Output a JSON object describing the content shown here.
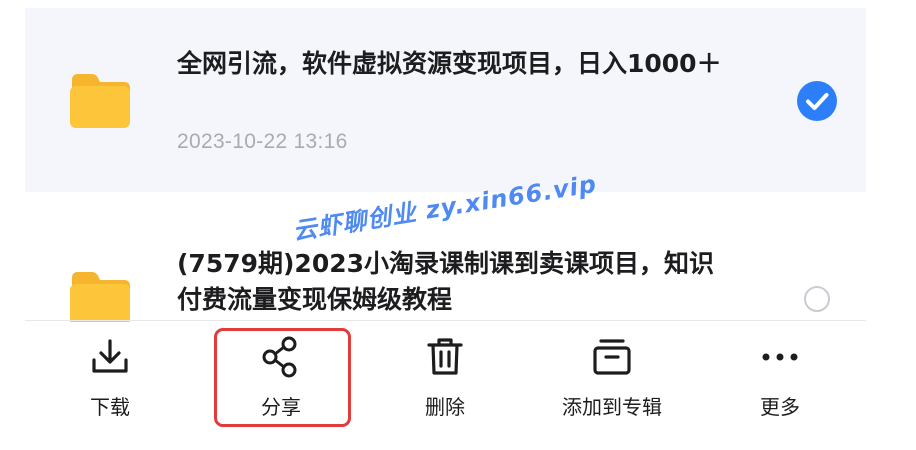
{
  "files": [
    {
      "title": "全网引流，软件虚拟资源变现项目，日入1000＋",
      "date": "2023-10-22 13:16",
      "selected": true,
      "icon": "folder-icon"
    },
    {
      "title": "(7579期)2023小淘录课制课到卖课项目，知识付费流量变现保姆级教程",
      "selected": false,
      "icon": "folder-icon"
    }
  ],
  "toolbar": {
    "download": {
      "label": "下载",
      "icon": "download-icon"
    },
    "share": {
      "label": "分享",
      "icon": "share-icon"
    },
    "delete": {
      "label": "删除",
      "icon": "trash-icon"
    },
    "add_to_album": {
      "label": "添加到专辑",
      "icon": "album-icon"
    },
    "more": {
      "label": "更多",
      "icon": "more-icon"
    }
  },
  "watermark": {
    "text": "云虾聊创业 zy.xin66.vip"
  },
  "colors": {
    "selected_bg": "#f4f6fb",
    "check_blue": "#2d7ff9",
    "folder_yellow": "#fcc53a",
    "highlight_red": "#e23b3b",
    "watermark_blue": "#3b7ef0"
  }
}
